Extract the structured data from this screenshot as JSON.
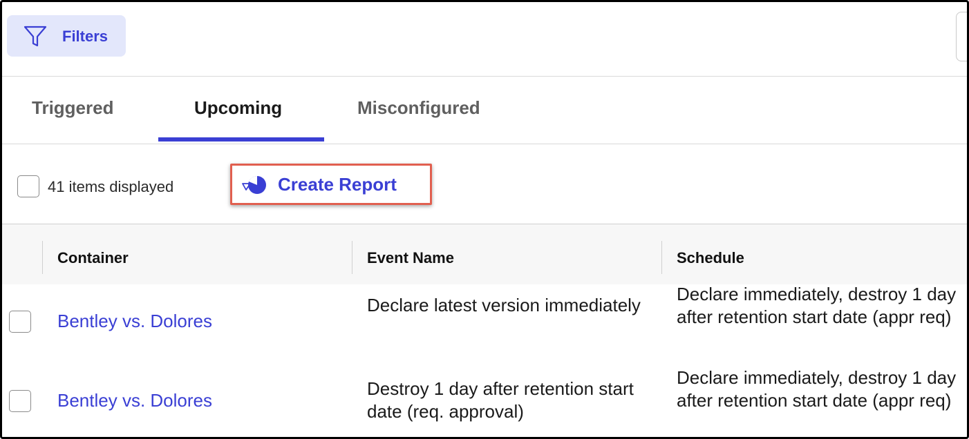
{
  "toolbar": {
    "filters_label": "Filters",
    "filters_icon": "filter-funnel-icon"
  },
  "tabs": [
    {
      "label": "Triggered",
      "active": false
    },
    {
      "label": "Upcoming",
      "active": true
    },
    {
      "label": "Misconfigured",
      "active": false
    }
  ],
  "actions": {
    "count_label": "41 items displayed",
    "create_report_label": "Create Report",
    "create_report_icon": "pie-chart-icon"
  },
  "table": {
    "columns": [
      "Container",
      "Event Name",
      "Schedule"
    ],
    "rows": [
      {
        "container": "Bentley vs. Dolores",
        "event_name": "Declare latest version immediately",
        "schedule": "Declare immediately, destroy 1 day after retention start date (appr req)"
      },
      {
        "container": "Bentley vs. Dolores",
        "event_name": "Destroy 1 day after retention start date (req. approval)",
        "schedule": "Declare immediately, destroy 1 day after retention start date (appr req)"
      }
    ]
  },
  "colors": {
    "accent": "#3a3fd4",
    "highlight": "#e15f4f",
    "filters_bg": "#e3e7fb"
  }
}
